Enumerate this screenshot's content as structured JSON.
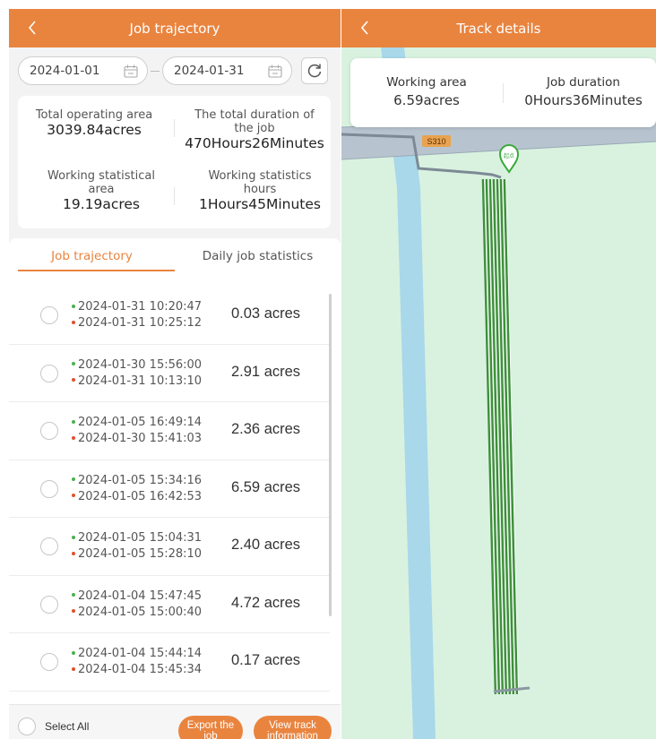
{
  "left": {
    "title": "Job trajectory",
    "date_start": "2024-01-01",
    "date_end": "2024-01-31",
    "stats": {
      "total_area_label": "Total operating area",
      "total_area_value": "3039.84acres",
      "total_duration_label": "The total duration of the job",
      "total_duration_value": "470Hours26Minutes",
      "working_area_label": "Working statistical area",
      "working_area_value": "19.19acres",
      "working_hours_label": "Working statistics hours",
      "working_hours_value": "1Hours45Minutes"
    },
    "tabs": [
      {
        "label": "Job trajectory",
        "active": true
      },
      {
        "label": "Daily job statistics",
        "active": false
      }
    ],
    "records": [
      {
        "start": "2024-01-31 10:20:47",
        "end": "2024-01-31 10:25:12",
        "acres": "0.03 acres"
      },
      {
        "start": "2024-01-30 15:56:00",
        "end": "2024-01-31 10:13:10",
        "acres": "2.91 acres"
      },
      {
        "start": "2024-01-05 16:49:14",
        "end": "2024-01-30 15:41:03",
        "acres": "2.36 acres"
      },
      {
        "start": "2024-01-05 15:34:16",
        "end": "2024-01-05 16:42:53",
        "acres": "6.59 acres"
      },
      {
        "start": "2024-01-05 15:04:31",
        "end": "2024-01-05 15:28:10",
        "acres": "2.40 acres"
      },
      {
        "start": "2024-01-04 15:47:45",
        "end": "2024-01-05 15:00:40",
        "acres": "4.72 acres"
      },
      {
        "start": "2024-01-04 15:44:14",
        "end": "2024-01-04 15:45:34",
        "acres": "0.17 acres"
      }
    ],
    "footer": {
      "select_all": "Select All",
      "export_line1": "Export the",
      "export_line2": "job",
      "view_line1": "View track",
      "view_line2": "information"
    }
  },
  "right": {
    "title": "Track details",
    "working_area_label": "Working area",
    "working_area_value": "6.59acres",
    "job_duration_label": "Job duration",
    "job_duration_value": "0Hours36Minutes",
    "road_label": "S310",
    "marker_label": "起点"
  },
  "colors": {
    "accent": "#e9843f",
    "start_dot": "#4caf50",
    "end_dot": "#e05030",
    "track": "#3e8f3a",
    "map_field": "#d9f2e0",
    "river": "#a8d8ea"
  },
  "icons": [
    "back-chevron-icon",
    "calendar-icon",
    "refresh-icon",
    "start-marker-icon"
  ]
}
